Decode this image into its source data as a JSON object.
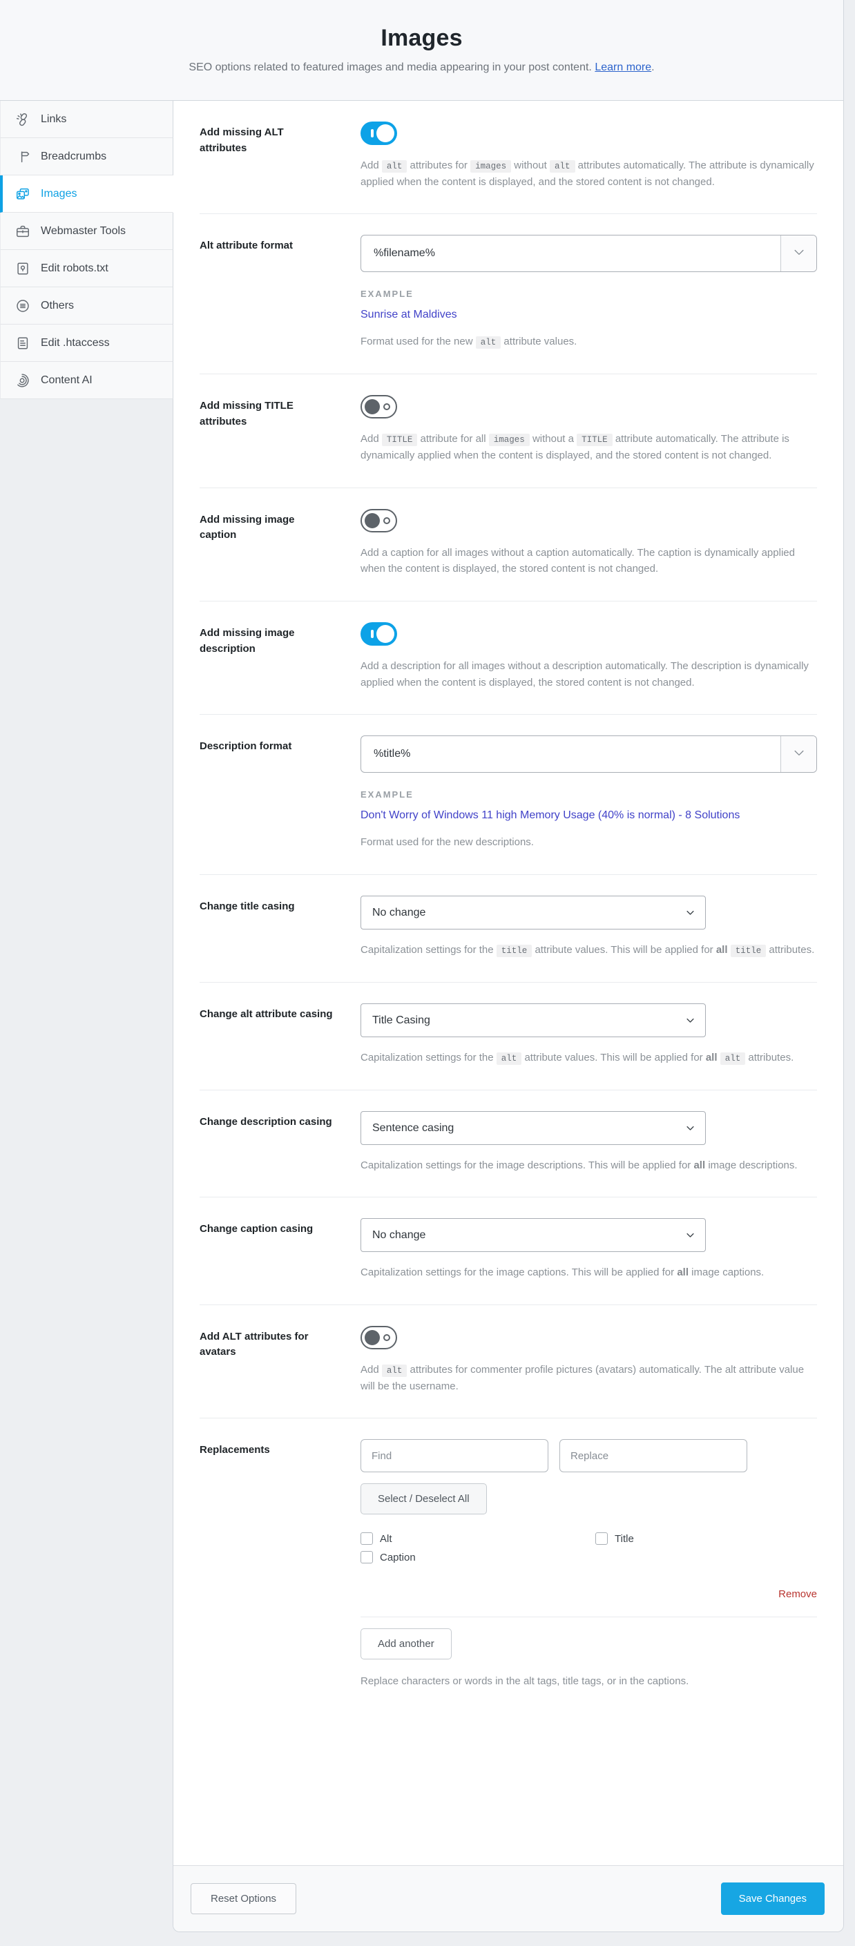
{
  "header": {
    "title": "Images",
    "subtitle_text": "SEO options related to featured images and media appearing in your post content.",
    "learn_more_label": "Learn more",
    "subtitle_suffix": "."
  },
  "sidebar": {
    "items": [
      {
        "id": "links",
        "label": "Links",
        "icon": "chain-links-icon",
        "active": false
      },
      {
        "id": "breadcrumbs",
        "label": "Breadcrumbs",
        "icon": "signpost-icon",
        "active": false
      },
      {
        "id": "images",
        "label": "Images",
        "icon": "images-icon",
        "active": true
      },
      {
        "id": "webmaster-tools",
        "label": "Webmaster Tools",
        "icon": "briefcase-icon",
        "active": false
      },
      {
        "id": "edit-robots-txt",
        "label": "Edit robots.txt",
        "icon": "folder-file-icon",
        "active": false
      },
      {
        "id": "others",
        "label": "Others",
        "icon": "circle-list-icon",
        "active": false
      },
      {
        "id": "edit-htaccess",
        "label": "Edit .htaccess",
        "icon": "document-icon",
        "active": false
      },
      {
        "id": "content-ai",
        "label": "Content AI",
        "icon": "content-ai-icon",
        "active": false
      }
    ]
  },
  "settings": [
    {
      "id": "add-missing-alt-attributes",
      "label": "Add missing ALT attributes",
      "control": {
        "type": "toggle",
        "state": "on"
      },
      "description": [
        {
          "t": "text",
          "v": "Add "
        },
        {
          "t": "code",
          "v": "alt"
        },
        {
          "t": "text",
          "v": " attributes for "
        },
        {
          "t": "code",
          "v": "images"
        },
        {
          "t": "text",
          "v": " without "
        },
        {
          "t": "code",
          "v": "alt"
        },
        {
          "t": "text",
          "v": " attributes automatically. The attribute is dynamically applied when the content is displayed, and the stored content is not changed."
        }
      ]
    },
    {
      "id": "alt-attribute-format",
      "label": "Alt attribute format",
      "control": {
        "type": "combo",
        "value": "%filename%"
      },
      "example_label": "EXAMPLE",
      "example_link": "Sunrise at Maldives",
      "description": [
        {
          "t": "text",
          "v": "Format used for the new "
        },
        {
          "t": "code",
          "v": "alt"
        },
        {
          "t": "text",
          "v": " attribute values."
        }
      ]
    },
    {
      "id": "add-missing-title-attributes",
      "label": "Add missing TITLE attributes",
      "control": {
        "type": "toggle",
        "state": "off"
      },
      "description": [
        {
          "t": "text",
          "v": "Add "
        },
        {
          "t": "code",
          "v": "TITLE"
        },
        {
          "t": "text",
          "v": " attribute for all "
        },
        {
          "t": "code",
          "v": "images"
        },
        {
          "t": "text",
          "v": " without a "
        },
        {
          "t": "code",
          "v": "TITLE"
        },
        {
          "t": "text",
          "v": " attribute automatically. The attribute is dynamically applied when the content is displayed, and the stored content is not changed."
        }
      ]
    },
    {
      "id": "add-missing-image-caption",
      "label": "Add missing image caption",
      "control": {
        "type": "toggle",
        "state": "off"
      },
      "description": [
        {
          "t": "text",
          "v": "Add a caption for all images without a caption automatically. The caption is dynamically applied when the content is displayed, the stored content is not changed."
        }
      ]
    },
    {
      "id": "add-missing-image-description",
      "label": "Add missing image description",
      "control": {
        "type": "toggle",
        "state": "on"
      },
      "description": [
        {
          "t": "text",
          "v": "Add a description for all images without a description automatically. The description is dynamically applied when the content is displayed, the stored content is not changed."
        }
      ]
    },
    {
      "id": "description-format",
      "label": "Description format",
      "control": {
        "type": "combo",
        "value": "%title%"
      },
      "example_label": "EXAMPLE",
      "example_link": "Don't Worry of Windows 11 high Memory Usage (40% is normal) - 8 Solutions",
      "description": [
        {
          "t": "text",
          "v": "Format used for the new descriptions."
        }
      ]
    },
    {
      "id": "change-title-casing",
      "label": "Change title casing",
      "control": {
        "type": "select",
        "value": "No change"
      },
      "description": [
        {
          "t": "text",
          "v": "Capitalization settings for the "
        },
        {
          "t": "code",
          "v": "title"
        },
        {
          "t": "text",
          "v": " attribute values. This will be applied for "
        },
        {
          "t": "b",
          "v": "all"
        },
        {
          "t": "text",
          "v": " "
        },
        {
          "t": "code",
          "v": "title"
        },
        {
          "t": "text",
          "v": " attributes."
        }
      ]
    },
    {
      "id": "change-alt-attribute-casing",
      "label": "Change alt attribute casing",
      "control": {
        "type": "select",
        "value": "Title Casing"
      },
      "description": [
        {
          "t": "text",
          "v": "Capitalization settings for the "
        },
        {
          "t": "code",
          "v": "alt"
        },
        {
          "t": "text",
          "v": " attribute values. This will be applied for "
        },
        {
          "t": "b",
          "v": "all"
        },
        {
          "t": "text",
          "v": " "
        },
        {
          "t": "code",
          "v": "alt"
        },
        {
          "t": "text",
          "v": " attributes."
        }
      ]
    },
    {
      "id": "change-description-casing",
      "label": "Change description casing",
      "control": {
        "type": "select",
        "value": "Sentence casing"
      },
      "description": [
        {
          "t": "text",
          "v": "Capitalization settings for the image descriptions. This will be applied for "
        },
        {
          "t": "b",
          "v": "all"
        },
        {
          "t": "text",
          "v": " image descriptions."
        }
      ]
    },
    {
      "id": "change-caption-casing",
      "label": "Change caption casing",
      "control": {
        "type": "select",
        "value": "No change"
      },
      "description": [
        {
          "t": "text",
          "v": "Capitalization settings for the image captions. This will be applied for "
        },
        {
          "t": "b",
          "v": "all"
        },
        {
          "t": "text",
          "v": " image captions."
        }
      ]
    },
    {
      "id": "add-alt-attributes-for-avatars",
      "label": "Add ALT attributes for avatars",
      "control": {
        "type": "toggle",
        "state": "off"
      },
      "description": [
        {
          "t": "text",
          "v": "Add "
        },
        {
          "t": "code",
          "v": "alt"
        },
        {
          "t": "text",
          "v": " attributes for commenter profile pictures (avatars) automatically. The alt attribute value will be the username."
        }
      ]
    },
    {
      "id": "replacements",
      "label": "Replacements",
      "control": {
        "type": "replacements"
      },
      "replacements": {
        "find_placeholder": "Find",
        "replace_placeholder": "Replace",
        "select_all_label": "Select / Deselect All",
        "checkboxes": [
          {
            "id": "alt",
            "label": "Alt",
            "checked": false
          },
          {
            "id": "title",
            "label": "Title",
            "checked": false
          },
          {
            "id": "caption",
            "label": "Caption",
            "checked": false
          }
        ],
        "remove_label": "Remove",
        "add_another_label": "Add another"
      },
      "description": [
        {
          "t": "text",
          "v": "Replace characters or words in the alt tags, title tags, or in the captions."
        }
      ]
    }
  ],
  "footer": {
    "reset_label": "Reset Options",
    "save_label": "Save Changes"
  },
  "colors": {
    "accent_blue": "#0ea1e4",
    "toggle_on": "#0da2e7",
    "save_button": "#17a6e3",
    "example_link": "#4142c8",
    "learn_more_link": "#2c63cc",
    "remove_red": "#b8342f",
    "page_background": "#edeff2",
    "header_background": "#f7f8fa"
  }
}
